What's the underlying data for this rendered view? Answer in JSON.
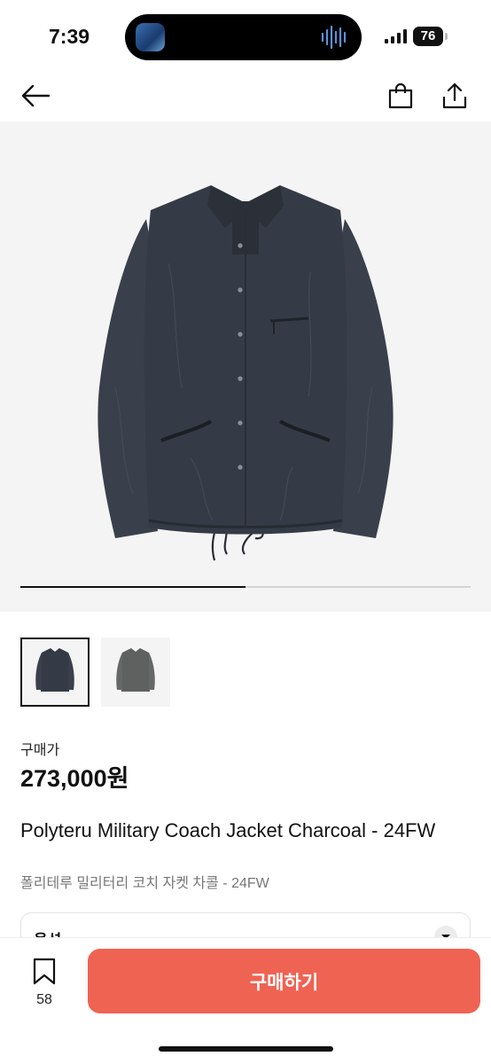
{
  "status_bar": {
    "time": "7:39",
    "battery": "76"
  },
  "nav": {
    "back_icon": "arrow-left-icon",
    "bag_icon": "shopping-bag-icon",
    "share_icon": "share-icon"
  },
  "gallery": {
    "progress": 0.5,
    "thumbnail_count": 2,
    "selected_index": 0
  },
  "product": {
    "price_label": "구매가",
    "price": "273,000원",
    "title_en": "Polyteru Military Coach Jacket Charcoal - 24FW",
    "title_ko": "폴리테루 밀리터리 코치 자켓 차콜 - 24FW"
  },
  "option": {
    "label": "옵션"
  },
  "bottom": {
    "bookmark_count": "58",
    "buy_label": "구매하기"
  },
  "colors": {
    "accent": "#ef6353",
    "image_bg": "#f4f4f4",
    "jacket": "#353b46"
  }
}
